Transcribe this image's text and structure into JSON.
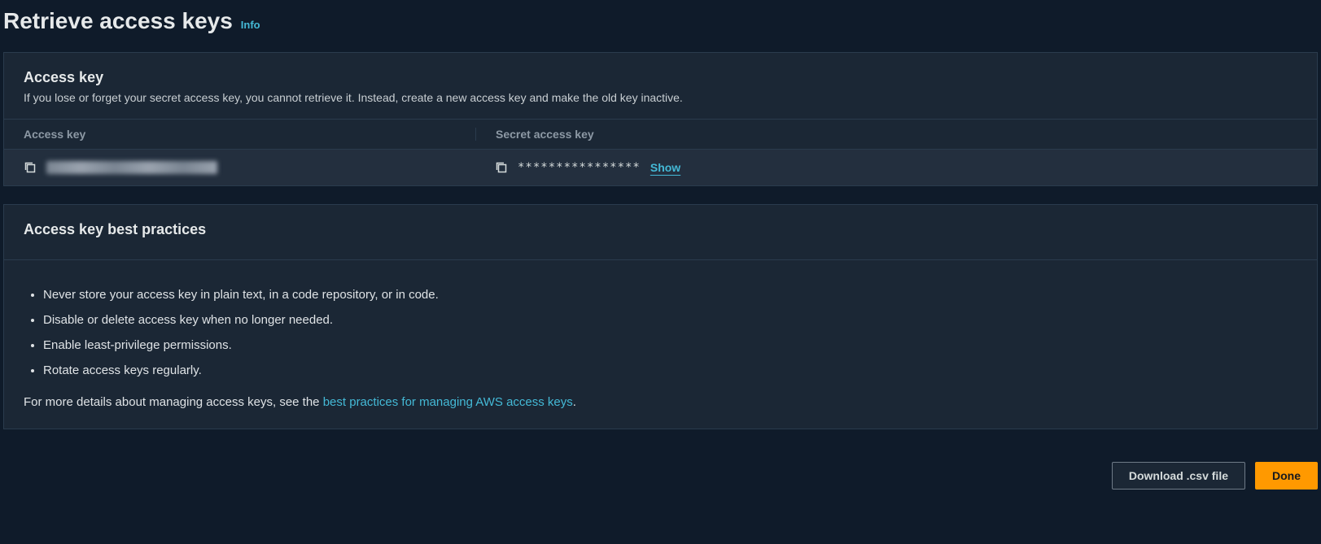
{
  "header": {
    "title": "Retrieve access keys",
    "info": "Info"
  },
  "access_key_panel": {
    "title": "Access key",
    "desc": "If you lose or forget your secret access key, you cannot retrieve it. Instead, create a new access key and make the old key inactive.",
    "col_access": "Access key",
    "col_secret": "Secret access key",
    "secret_masked": "****************",
    "show_label": "Show"
  },
  "best_practices": {
    "title": "Access key best practices",
    "items": [
      "Never store your access key in plain text, in a code repository, or in code.",
      "Disable or delete access key when no longer needed.",
      "Enable least-privilege permissions.",
      "Rotate access keys regularly."
    ],
    "footer_prefix": "For more details about managing access keys, see the ",
    "footer_link": "best practices for managing AWS access keys",
    "footer_suffix": "."
  },
  "footer": {
    "download": "Download .csv file",
    "done": "Done"
  }
}
